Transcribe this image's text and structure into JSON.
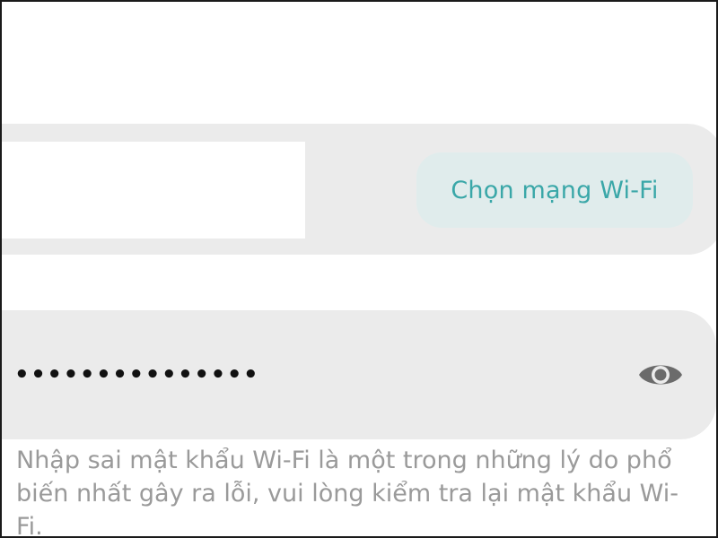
{
  "network": {
    "choose_wifi_label": "Chọn mạng Wi-Fi"
  },
  "password": {
    "masked_value": "•••••••••••••••",
    "visibility_icon": "eye-icon"
  },
  "helper": {
    "text": "Nhập sai mật khẩu Wi-Fi là một trong những lý do phổ biến nhất gây ra lỗi, vui lòng kiểm tra lại mật khẩu Wi-Fi."
  },
  "colors": {
    "card_background": "#ebebeb",
    "accent": "#3aa7a8",
    "accent_button_bg": "#e0ecec",
    "helper_text": "#9a9a9a",
    "icon": "#6b6b6b"
  }
}
